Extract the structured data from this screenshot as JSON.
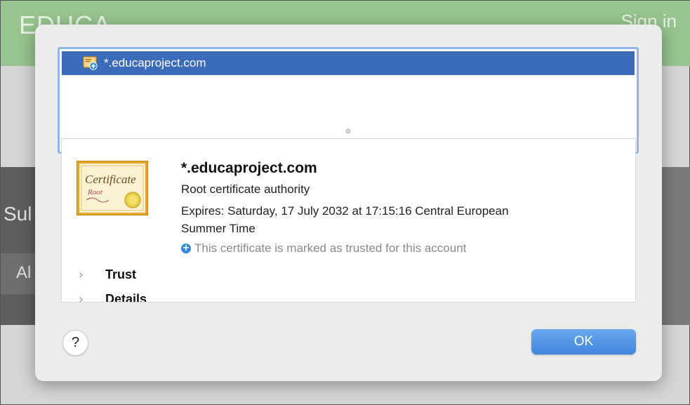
{
  "background": {
    "logo": "EDUCA",
    "sign_in": "Sign in",
    "sub_text": "Sul",
    "al_text": "Al"
  },
  "dialog": {
    "list": {
      "selected_item": "*.educaproject.com",
      "icon": "certificate-icon"
    },
    "details": {
      "image_icon": "certificate-image",
      "title": "*.educaproject.com",
      "type": "Root certificate authority",
      "expires_line1": "Expires: Saturday, 17 July 2032 at 17:15:16 Central European",
      "expires_line2": "Summer Time",
      "trusted_icon": "plus-circle-icon",
      "trusted_text": "This certificate is marked as trusted for this account",
      "sections": [
        "Trust",
        "Details"
      ]
    },
    "help_label": "?",
    "ok_label": "OK"
  },
  "colors": {
    "header_green": "#97c48f",
    "selection_blue": "#3c6bb9",
    "ok_blue": "#4a90e2",
    "trusted_blue": "#2f8bd8"
  }
}
